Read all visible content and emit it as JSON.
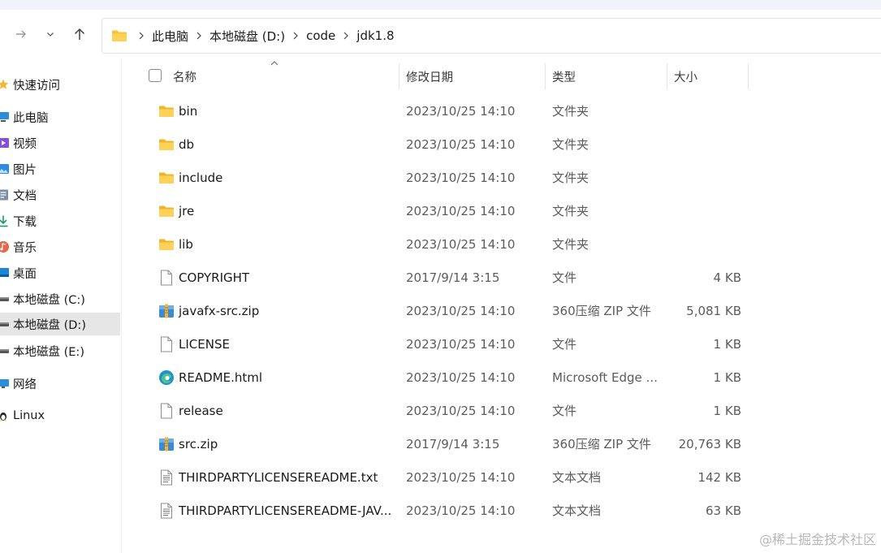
{
  "address": {
    "crumbs": [
      "此电脑",
      "本地磁盘 (D:)",
      "code",
      "jdk1.8"
    ]
  },
  "sidebar": {
    "items": [
      {
        "label": "快速访问",
        "icon": "star-icon"
      },
      {
        "label": "此电脑",
        "icon": "computer-icon"
      },
      {
        "label": "视频",
        "icon": "video-icon"
      },
      {
        "label": "图片",
        "icon": "picture-icon"
      },
      {
        "label": "文档",
        "icon": "document-icon"
      },
      {
        "label": "下载",
        "icon": "download-icon"
      },
      {
        "label": "音乐",
        "icon": "music-icon"
      },
      {
        "label": "桌面",
        "icon": "desktop-icon"
      },
      {
        "label": "本地磁盘 (C:)",
        "icon": "drive-icon"
      },
      {
        "label": "本地磁盘 (D:)",
        "icon": "drive-icon",
        "selected": true
      },
      {
        "label": "本地磁盘 (E:)",
        "icon": "drive-icon"
      },
      {
        "label": "网络",
        "icon": "network-icon"
      },
      {
        "label": "Linux",
        "icon": "linux-icon"
      }
    ]
  },
  "columns": {
    "name": "名称",
    "date": "修改日期",
    "type": "类型",
    "size": "大小"
  },
  "files": [
    {
      "name": "bin",
      "date": "2023/10/25 14:10",
      "type": "文件夹",
      "size": "",
      "icon": "folder-icon"
    },
    {
      "name": "db",
      "date": "2023/10/25 14:10",
      "type": "文件夹",
      "size": "",
      "icon": "folder-icon"
    },
    {
      "name": "include",
      "date": "2023/10/25 14:10",
      "type": "文件夹",
      "size": "",
      "icon": "folder-icon"
    },
    {
      "name": "jre",
      "date": "2023/10/25 14:10",
      "type": "文件夹",
      "size": "",
      "icon": "folder-icon"
    },
    {
      "name": "lib",
      "date": "2023/10/25 14:10",
      "type": "文件夹",
      "size": "",
      "icon": "folder-icon"
    },
    {
      "name": "COPYRIGHT",
      "date": "2017/9/14 3:15",
      "type": "文件",
      "size": "4 KB",
      "icon": "file-icon"
    },
    {
      "name": "javafx-src.zip",
      "date": "2023/10/25 14:10",
      "type": "360压缩 ZIP 文件",
      "size": "5,081 KB",
      "icon": "zip-icon"
    },
    {
      "name": "LICENSE",
      "date": "2023/10/25 14:10",
      "type": "文件",
      "size": "1 KB",
      "icon": "file-icon"
    },
    {
      "name": "README.html",
      "date": "2023/10/25 14:10",
      "type": "Microsoft Edge ...",
      "size": "1 KB",
      "icon": "edge-icon"
    },
    {
      "name": "release",
      "date": "2023/10/25 14:10",
      "type": "文件",
      "size": "1 KB",
      "icon": "file-icon"
    },
    {
      "name": "src.zip",
      "date": "2017/9/14 3:15",
      "type": "360压缩 ZIP 文件",
      "size": "20,763 KB",
      "icon": "zip-icon"
    },
    {
      "name": "THIRDPARTYLICENSEREADME.txt",
      "date": "2023/10/25 14:10",
      "type": "文本文档",
      "size": "142 KB",
      "icon": "text-file-icon"
    },
    {
      "name": "THIRDPARTYLICENSEREADME-JAV...",
      "date": "2023/10/25 14:10",
      "type": "文本文档",
      "size": "63 KB",
      "icon": "text-file-icon"
    }
  ],
  "watermark": "@稀土掘金技术社区",
  "colors": {
    "folder": "#f8c33a",
    "selection": "#e6e6e6",
    "edge": "#1f8fd6",
    "zip": "#3b8ccf"
  }
}
